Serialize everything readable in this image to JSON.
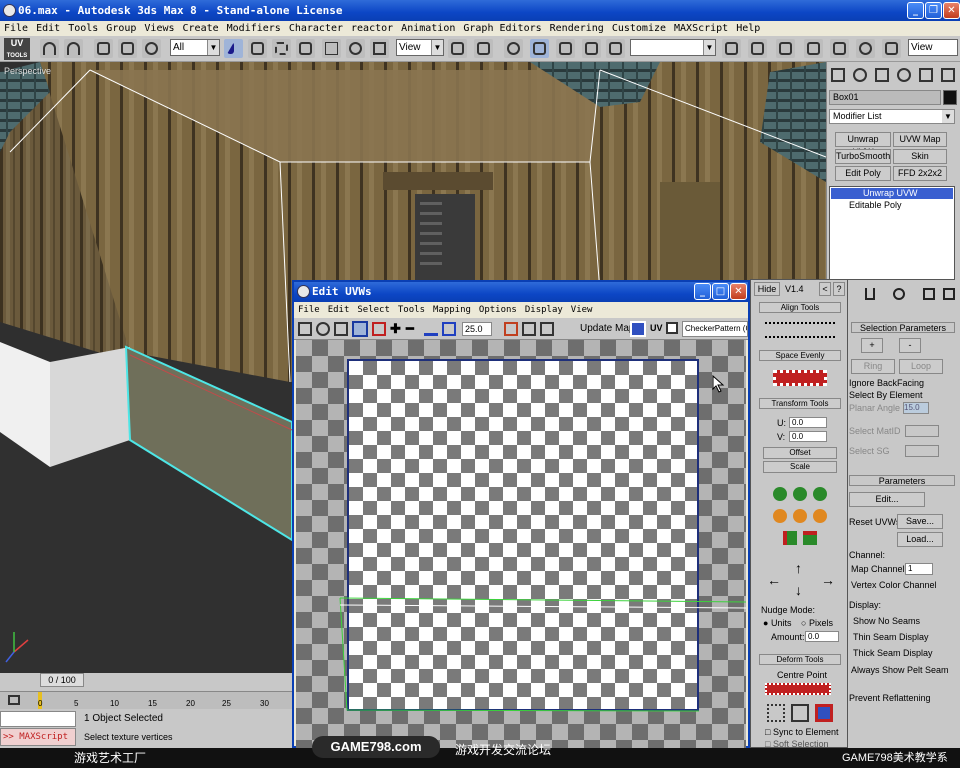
{
  "window": {
    "title": "06.max - Autodesk 3ds Max 8 - Stand-alone License"
  },
  "menubar": [
    "File",
    "Edit",
    "Tools",
    "Group",
    "Views",
    "Create",
    "Modifiers",
    "Character",
    "reactor",
    "Animation",
    "Graph Editors",
    "Rendering",
    "Customize",
    "MAXScript",
    "Help"
  ],
  "toolbar": {
    "uv_tools_label": "UV",
    "uv_tools_sub": "TOOLS",
    "selection_filter": "All",
    "ref_coord": "View",
    "named_sel": "",
    "view_select": "View"
  },
  "viewport": {
    "label": "Perspective"
  },
  "command_panel": {
    "object_name": "Box01",
    "modifier_list": "Modifier List",
    "modifier_buttons": [
      "Unwrap UVW",
      "UVW Map",
      "TurboSmooth",
      "Skin",
      "Edit Poly",
      "FFD 2x2x2"
    ],
    "stack": [
      "Unwrap UVW",
      "Editable Poly"
    ],
    "rollout_selection_title": "Selection Parameters",
    "plus": "+",
    "minus": "-",
    "ring": "Ring",
    "loop": "Loop",
    "ignore_backfacing": "Ignore BackFacing",
    "select_by_element": "Select By Element",
    "planar_angle_label": "Planar Angle",
    "planar_angle_value": "15.0",
    "select_mat_id": "Select MatID",
    "select_sg": "Select SG",
    "parameters_title": "Parameters",
    "edit_btn": "Edit...",
    "reset_uvws": "Reset UVWs",
    "save_btn": "Save...",
    "load_btn": "Load...",
    "channel_label": "Channel:",
    "map_channel_label": "Map Channel:",
    "map_channel_value": "1",
    "vertex_color_channel": "Vertex Color Channel",
    "display_label": "Display:",
    "show_no_seams": "Show No Seams",
    "thin_seam": "Thin Seam Display",
    "thick_seam": "Thick Seam Display",
    "always_show_pelt": "Always Show Pelt Seam",
    "prevent_reflattening": "Prevent Reflattening"
  },
  "unwrap_panel": {
    "hide_btn": "Hide",
    "version": "V1.4",
    "lt": "<",
    "q": "?",
    "align_tools": "Align Tools",
    "space_evenly": "Space Evenly",
    "transform_tools": "Transform Tools",
    "u_label": "U:",
    "u_value": "0.0",
    "v_label": "V:",
    "v_value": "0.0",
    "offset": "Offset",
    "scale": "Scale",
    "nudge_mode": "Nudge Mode:",
    "units": "Units",
    "pixels": "Pixels",
    "amount_label": "Amount:",
    "amount_value": "0.0",
    "deform_tools": "Deform Tools",
    "centre_point": "Centre Point",
    "sync_to_element": "Sync to Element",
    "soft_selection": "Soft Selection"
  },
  "edit_uvw": {
    "title": "Edit UVWs",
    "menu": [
      "File",
      "Edit",
      "Select",
      "Tools",
      "Mapping",
      "Options",
      "Display",
      "View"
    ],
    "zoom_value": "25.0",
    "update_map": "Update Map",
    "uv_label": "UV",
    "texture_select": "CheckerPattern (Checker)"
  },
  "timeline": {
    "frame_counter": "0 / 100",
    "ticks": [
      "0",
      "5",
      "10",
      "15",
      "20",
      "25",
      "30"
    ]
  },
  "status": {
    "maxscript_label": ">> MAXScript",
    "objects_selected": "1 Object Selected",
    "prompt": "Select texture vertices"
  },
  "footer": {
    "left": "游戏艺术工厂",
    "site": "GAME798.com",
    "middle": "游戏开发交流论坛",
    "right": "GAME798美术教学系"
  },
  "colors": {
    "titlebar": "#0c46c5",
    "uv_border": "#1e2f7a",
    "selection_cyan": "#4ee6e6",
    "seam_green": "#3cd23c"
  }
}
